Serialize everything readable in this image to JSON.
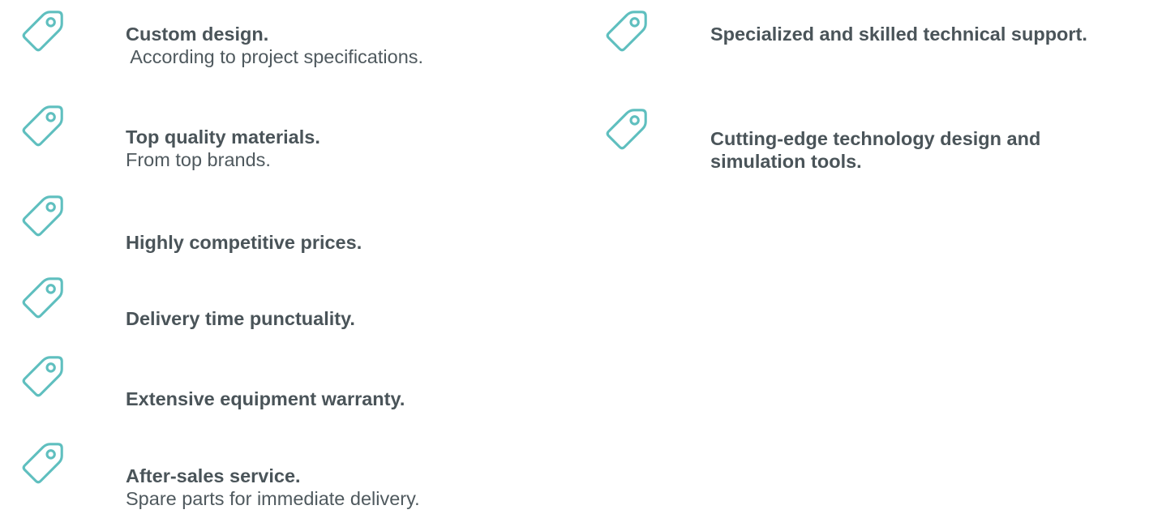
{
  "colors": {
    "icon": "#5fbfbf",
    "text": "#4a5459"
  },
  "icon_name": "tag-icon",
  "features": [
    {
      "title": "Custom design.",
      "subtitle": " According to project specifications."
    },
    {
      "title": "Top quality materials.",
      "subtitle": "From top brands."
    },
    {
      "title": "Highly competitive prices.",
      "subtitle": ""
    },
    {
      "title": "Delivery time punctuality.",
      "subtitle": ""
    },
    {
      "title": "Extensive equipment warranty.",
      "subtitle": ""
    },
    {
      "title": "After-sales service.",
      "subtitle": "Spare parts for immediate delivery."
    },
    {
      "title": "Specialized and skilled technical support.",
      "subtitle": ""
    },
    {
      "title": "Cutting-edge technology design and simulation tools.",
      "subtitle": ""
    }
  ]
}
